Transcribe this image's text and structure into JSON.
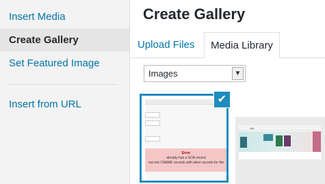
{
  "menu": {
    "items": [
      {
        "label": "Insert Media"
      },
      {
        "label": "Create Gallery"
      },
      {
        "label": "Set Featured Image"
      },
      {
        "label": "Insert from URL"
      }
    ]
  },
  "frame": {
    "title": "Create Gallery"
  },
  "router": {
    "tabs": [
      {
        "label": "Upload Files"
      },
      {
        "label": "Media Library"
      }
    ]
  },
  "filter": {
    "selected": "Images"
  },
  "attachments": [
    {
      "selected": true,
      "icon": "checkmark-icon",
      "error_title": "Error",
      "error_line1": "already has a SOA record",
      "error_line2": "not mix CNAME records with other records for the"
    },
    {
      "selected": false,
      "site_logo": "Jolt"
    }
  ],
  "colors": {
    "link": "#0073aa",
    "selection": "#1e8cbe",
    "menu_bg": "#f3f3f3",
    "menu_active_bg": "#e5e5e5"
  }
}
